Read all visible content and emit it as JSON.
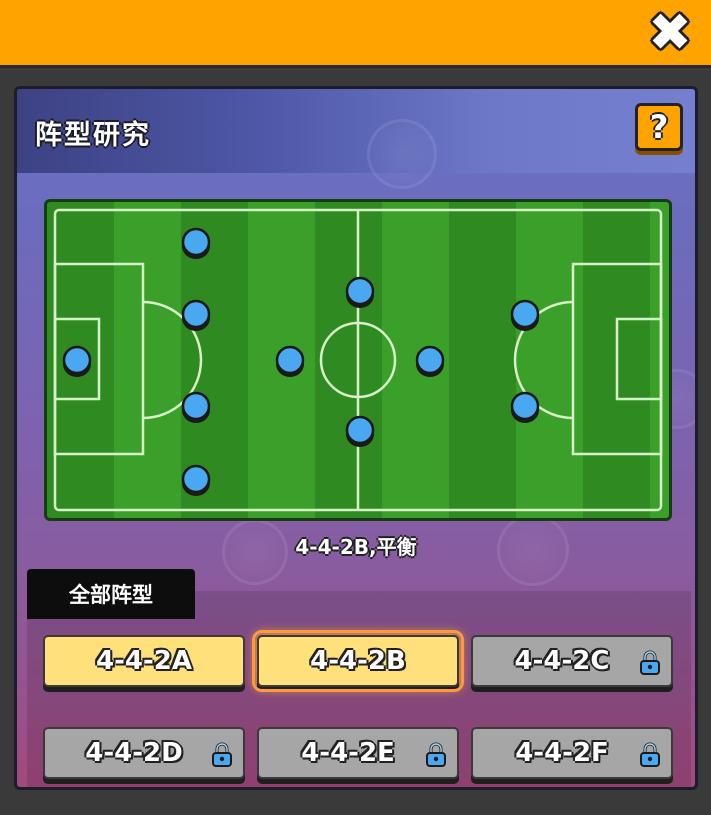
{
  "header": {
    "close_icon": "close-x-icon",
    "title": "阵型研究",
    "help_label": "?"
  },
  "pitch": {
    "players": [
      {
        "role": "GK"
      },
      {
        "role": "DF"
      },
      {
        "role": "DF"
      },
      {
        "role": "DF"
      },
      {
        "role": "DF"
      },
      {
        "role": "MF"
      },
      {
        "role": "MF"
      },
      {
        "role": "MF"
      },
      {
        "role": "MF"
      },
      {
        "role": "FW"
      },
      {
        "role": "FW"
      }
    ]
  },
  "formation_caption": "4-4-2B,平衡",
  "tab_all_label": "全部阵型",
  "formations": [
    {
      "label": "4-4-2A",
      "locked": false,
      "selected": false
    },
    {
      "label": "4-4-2B",
      "locked": false,
      "selected": true
    },
    {
      "label": "4-4-2C",
      "locked": true,
      "selected": false
    },
    {
      "label": "4-4-2D",
      "locked": true,
      "selected": false
    },
    {
      "label": "4-4-2E",
      "locked": true,
      "selected": false
    },
    {
      "label": "4-4-2F",
      "locked": true,
      "selected": false
    }
  ],
  "colors": {
    "topbar": "#ffa300",
    "player_dot": "#4aa8f0",
    "unlocked_button": "#ffe07a",
    "locked_button": "#a6a6a6"
  }
}
